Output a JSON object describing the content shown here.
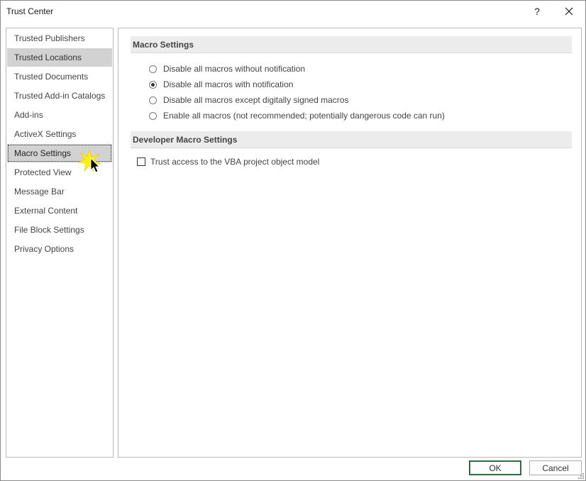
{
  "window": {
    "title": "Trust Center",
    "help_glyph": "?",
    "close_icon": "close-icon"
  },
  "sidebar": {
    "items": [
      {
        "label": "Trusted Publishers"
      },
      {
        "label": "Trusted Locations"
      },
      {
        "label": "Trusted Documents"
      },
      {
        "label": "Trusted Add-in Catalogs"
      },
      {
        "label": "Add-ins"
      },
      {
        "label": "ActiveX Settings"
      },
      {
        "label": "Macro Settings"
      },
      {
        "label": "Protected View"
      },
      {
        "label": "Message Bar"
      },
      {
        "label": "External Content"
      },
      {
        "label": "File Block Settings"
      },
      {
        "label": "Privacy Options"
      }
    ],
    "hovered_item": "Trusted Locations",
    "selected_item": "Macro Settings"
  },
  "macro_settings": {
    "header": "Macro Settings",
    "options": [
      {
        "label": "Disable all macros without notification",
        "checked": false
      },
      {
        "label": "Disable all macros with notification",
        "checked": true
      },
      {
        "label": "Disable all macros except digitally signed macros",
        "checked": false
      },
      {
        "label": "Enable all macros (not recommended; potentially dangerous code can run)",
        "checked": false
      }
    ]
  },
  "developer_settings": {
    "header": "Developer Macro Settings",
    "vba_access_label": "Trust access to the VBA project object model",
    "vba_access_checked": false
  },
  "buttons": {
    "ok_label": "OK",
    "cancel_label": "Cancel"
  },
  "colors": {
    "selection_bg": "#d2d2d2",
    "section_header_bg": "#ececec",
    "default_button_border": "#2e6b46"
  }
}
